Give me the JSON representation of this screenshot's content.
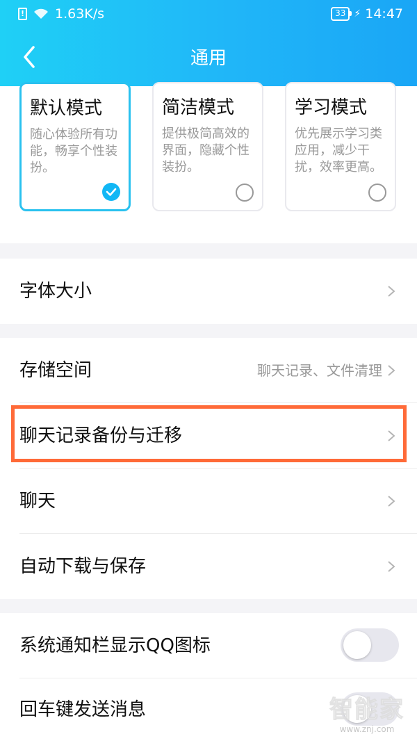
{
  "status_bar": {
    "network_speed": "1.63K/s",
    "battery": "33",
    "time": "14:47"
  },
  "header": {
    "title": "通用"
  },
  "modes": [
    {
      "title": "默认模式",
      "desc": "随心体验所有功能，畅享个性装扮。",
      "selected": true
    },
    {
      "title": "简洁模式",
      "desc": "提供极简高效的界面，隐藏个性装扮。",
      "selected": false
    },
    {
      "title": "学习模式",
      "desc": "优先展示学习类应用，减少干扰，效率更高。",
      "selected": false
    }
  ],
  "settings": {
    "font_size": {
      "label": "字体大小"
    },
    "storage": {
      "label": "存储空间",
      "hint": "聊天记录、文件清理"
    },
    "chat_backup": {
      "label": "聊天记录备份与迁移"
    },
    "chat": {
      "label": "聊天"
    },
    "auto_download": {
      "label": "自动下载与保存"
    },
    "notif_icon": {
      "label": "系统通知栏显示QQ图标",
      "enabled": false
    },
    "enter_send": {
      "label": "回车键发送消息",
      "enabled": false
    }
  },
  "watermark": {
    "brand": "智能家",
    "url": "www.znj.com"
  },
  "colors": {
    "header": "#20b6f8",
    "accent": "#12b7f5",
    "highlight": "#ff6a38"
  }
}
